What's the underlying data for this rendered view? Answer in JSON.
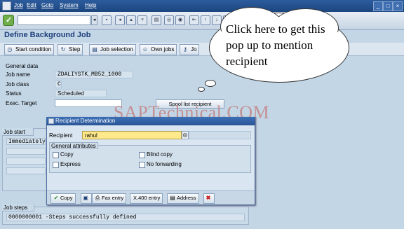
{
  "menu": {
    "items": [
      "Job",
      "Edit",
      "Goto",
      "System",
      "Help"
    ]
  },
  "toolbar": {
    "command_value": ""
  },
  "page_title": "Define Background Job",
  "app_toolbar": {
    "buttons": [
      {
        "label": "Start condition",
        "icon": "clock-icon"
      },
      {
        "label": "Step",
        "icon": "step-icon"
      },
      {
        "label": "Job selection",
        "icon": "list-icon"
      },
      {
        "label": "Own jobs",
        "icon": "person-icon"
      },
      {
        "label": "Jo",
        "icon": "key-icon"
      }
    ]
  },
  "general_data": {
    "section_label": "General data",
    "fields": [
      {
        "label": "Job name",
        "value": "ZDALIYSTK_MB52_1000"
      },
      {
        "label": "Job class",
        "value": "C"
      },
      {
        "label": "Status",
        "value": "Scheduled"
      },
      {
        "label": "Exec. Target",
        "value": ""
      }
    ],
    "spool_button": "Spool list recipient"
  },
  "callout_text": "Click here to get this pop up to mention recipient",
  "watermark": "SAPTechnical.COM",
  "job_start": {
    "label": "Job start",
    "value": "Immediately"
  },
  "dialog": {
    "title": "Recipient Determination",
    "recipient_label": "Recipient",
    "recipient_value": "rahul",
    "attributes_label": "General attributes",
    "checkboxes": [
      "Copy",
      "Express",
      "Blind copy",
      "No forwarding"
    ],
    "buttons": [
      "Copy",
      "Fax entry",
      "X.400 entry",
      "Address"
    ]
  },
  "job_steps": {
    "label": "Job steps",
    "value": "0000000001 -Steps successfully defined"
  }
}
